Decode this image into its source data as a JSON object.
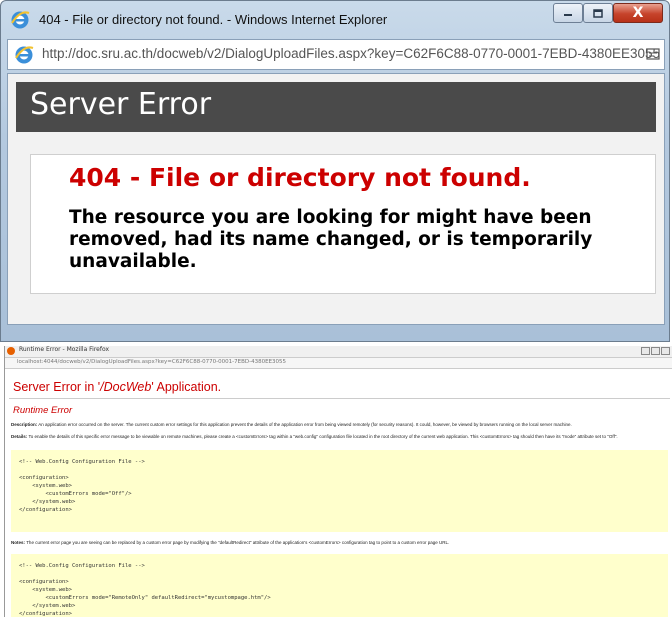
{
  "ie": {
    "window_title": "404 - File or directory not found. - Windows Internet Explorer",
    "address": "http://doc.sru.ac.th/docweb/v2/DialogUploadFiles.aspx?key=C62F6C88-0770-0001-7EBD-4380EE3055",
    "minimize_icon": "minimize-icon",
    "maximize_icon": "maximize-icon",
    "close_label": "X",
    "page": {
      "header": "Server Error",
      "error_title": "404 - File or directory not found.",
      "error_message": "The resource you are looking for might have been removed, had its name changed, or is temporarily unavailable."
    }
  },
  "firefox": {
    "window_title": "Runtime Error - Mozilla Firefox",
    "address": "localhost:4044/docweb/v2/DialogUploadFiles.aspx?key=C62F6C88-0770-0001-7EBD-4380EE3055",
    "page": {
      "heading_prefix": "Server Error in '",
      "heading_app": "/DocWeb",
      "heading_suffix": "' Application.",
      "subheading": "Runtime Error",
      "description_label": "Description:",
      "description_text": "An application error occurred on the server. The current custom error settings for this application prevent the details of the application error from being viewed remotely (for security reasons). It could, however, be viewed by browsers running on the local server machine.",
      "details_label": "Details:",
      "details_text": "To enable the details of this specific error message to be viewable on remote machines, please create a <customErrors> tag within a \"web.config\" configuration file located in the root directory of the current web application. This <customErrors> tag should then have its \"mode\" attribute set to \"Off\".",
      "code1": "<!-- Web.Config Configuration File -->\n\n<configuration>\n    <system.web>\n        <customErrors mode=\"Off\"/>\n    </system.web>\n</configuration>",
      "notes_label": "Notes:",
      "notes_text": "The current error page you are seeing can be replaced by a custom error page by modifying the \"defaultRedirect\" attribute of the application's <customErrors> configuration tag to point to a custom error page URL.",
      "code2": "<!-- Web.Config Configuration File -->\n\n<configuration>\n    <system.web>\n        <customErrors mode=\"RemoteOnly\" defaultRedirect=\"mycustompage.htm\"/>\n    </system.web>\n</configuration>"
    }
  }
}
